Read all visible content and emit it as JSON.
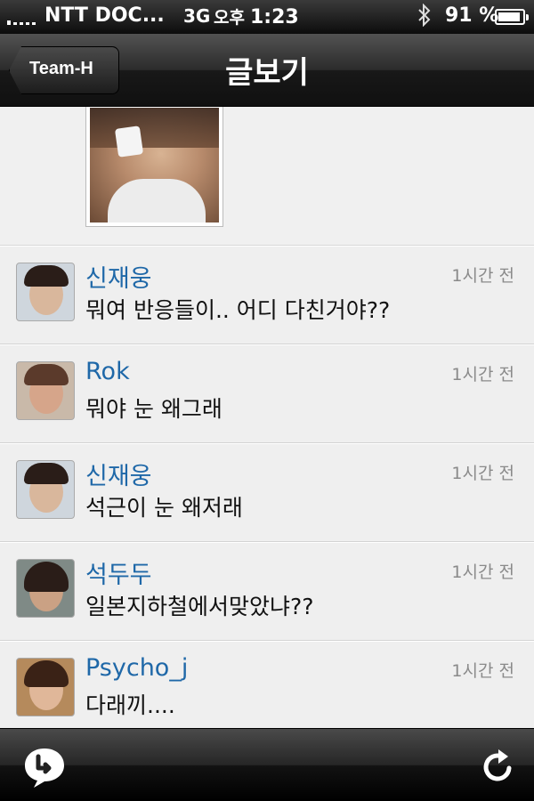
{
  "status_bar": {
    "carrier": "NTT DOC...",
    "network": "3G",
    "ampm": "오후",
    "time": "1:23",
    "battery_percent": "91 %",
    "battery_level": 0.91,
    "bluetooth_icon": "bluetooth-icon"
  },
  "nav": {
    "back_label": "Team-H",
    "title": "글보기"
  },
  "comments": [
    {
      "author": "신재웅",
      "time": "1시간 전",
      "text": "뭐여 반응들이.. 어디 다친거야??"
    },
    {
      "author": "Rok",
      "time": "1시간 전",
      "text": "뭐야 눈 왜그래"
    },
    {
      "author": "신재웅",
      "time": "1시간 전",
      "text": "석근이 눈 왜저래"
    },
    {
      "author": "석두두",
      "time": "1시간 전",
      "text": "일본지하철에서맞았냐??"
    },
    {
      "author": "Psycho_j",
      "time": "1시간 전",
      "text": "다래끼...."
    }
  ],
  "toolbar": {
    "reply_icon": "reply-bubble-icon",
    "refresh_icon": "refresh-icon"
  },
  "colors": {
    "author_link": "#1f68a8",
    "timestamp": "#8a8a8a",
    "content_bg": "#efefef"
  }
}
